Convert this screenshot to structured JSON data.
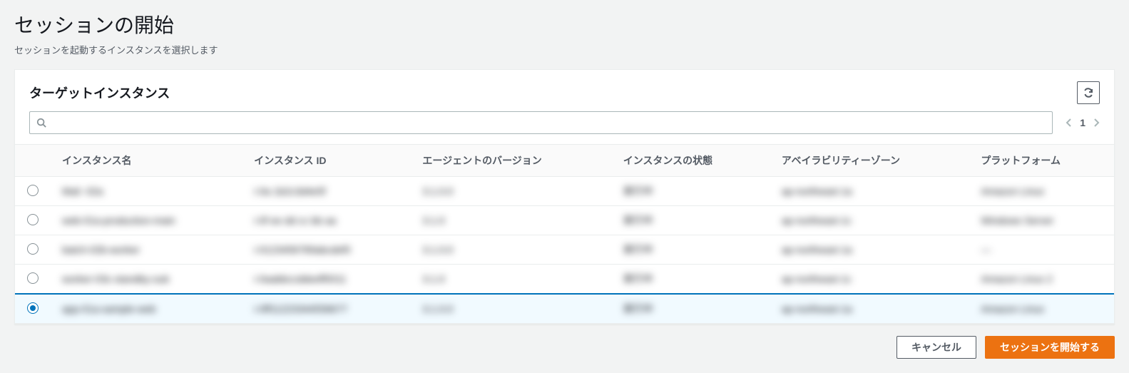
{
  "page": {
    "title": "セッションの開始",
    "subtitle": "セッションを起動するインスタンスを選択します"
  },
  "panel": {
    "title": "ターゲットインスタンス"
  },
  "search": {
    "value": "",
    "placeholder": ""
  },
  "pagination": {
    "page": "1"
  },
  "table": {
    "headers": {
      "name": "インスタンス名",
      "id": "インスタンス ID",
      "agent": "エージェントのバージョン",
      "state": "インスタンスの状態",
      "az": "アベイラビリティーゾーン",
      "platform": "プラットフォーム"
    },
    "rows": [
      {
        "selected": false,
        "name": "Mail -02a",
        "id": "i-0a 1b2c3d4e5f",
        "agent": "3.1.0.0",
        "state": "実行中",
        "az": "ap-northeast-1a",
        "platform": "Amazon Linux"
      },
      {
        "selected": false,
        "name": "web-01a-production-main",
        "id": "i-0f ee dd cc bb aa",
        "agent": "3.1.0",
        "state": "実行中",
        "az": "ap-northeast-1c",
        "platform": "Windows Server"
      },
      {
        "selected": false,
        "name": "batch-02b-worker",
        "id": "i-0123456789abcdef0",
        "agent": "3.1.0.0",
        "state": "実行中",
        "az": "ap-northeast-1a",
        "platform": "—"
      },
      {
        "selected": false,
        "name": "worker-03c-standby-sub",
        "id": "i-0aabbccddeeff0011",
        "agent": "3.1.0",
        "state": "実行中",
        "az": "ap-northeast-1c",
        "platform": "Amazon Linux 2"
      },
      {
        "selected": true,
        "name": "app-01a-sample-web",
        "id": "i-0ff11223344556677",
        "agent": "3.1.0.0",
        "state": "実行中",
        "az": "ap-northeast-1a",
        "platform": "Amazon Linux"
      }
    ]
  },
  "actions": {
    "cancel": "キャンセル",
    "start": "セッションを開始する"
  }
}
